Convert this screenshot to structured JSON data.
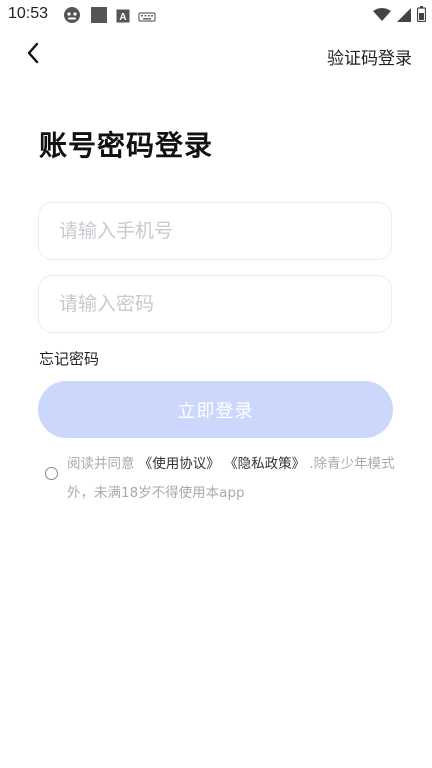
{
  "status_bar": {
    "time": "10:53",
    "left_icons": [
      "android-debug-icon",
      "square-notification-icon",
      "a-notification-icon",
      "keyboard-icon"
    ],
    "right_icons": [
      "wifi-icon",
      "signal-icon",
      "battery-icon"
    ]
  },
  "header": {
    "back_icon": "chevron-left-icon",
    "sms_login_label": "验证码登录"
  },
  "title": "账号密码登录",
  "form": {
    "phone_placeholder": "请输入手机号",
    "phone_value": "",
    "password_placeholder": "请输入密码",
    "password_value": "",
    "forgot_label": "忘记密码",
    "login_label": "立即登录"
  },
  "agreement": {
    "checked": false,
    "prefix": "阅读并同意",
    "user_agreement": "《使用协议》",
    "privacy_policy": "《隐私政策》",
    "suffix": ".除青少年模式外，未满18岁不得使用本app"
  },
  "colors": {
    "login_button_bg": "#ccd8fb",
    "text_primary": "#222222",
    "placeholder": "#c9c9cf",
    "muted": "#aaaaaa"
  }
}
